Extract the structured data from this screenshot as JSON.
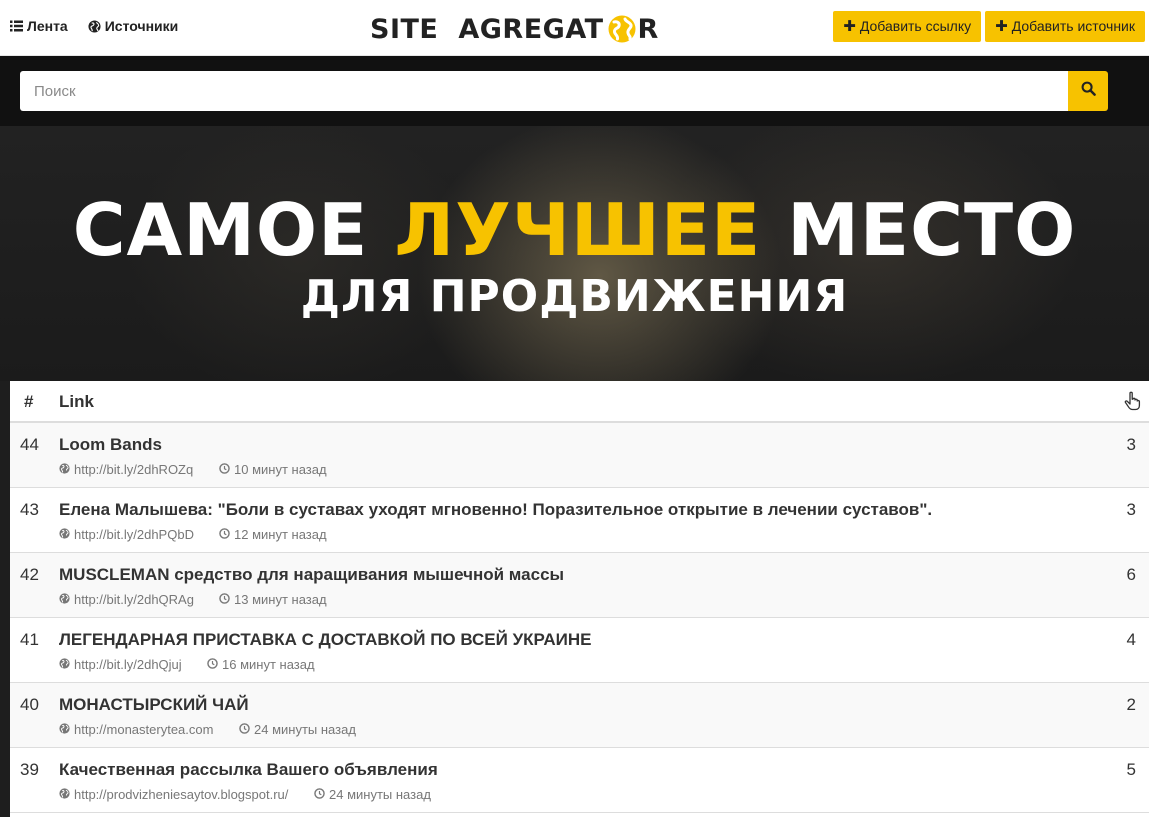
{
  "nav": {
    "feed_label": "Лента",
    "sources_label": "Источники",
    "brand_left": "SITE",
    "brand_right_a": "AGREGAT",
    "brand_right_b": "R",
    "add_link_label": "Добавить ссылку",
    "add_source_label": "Добавить источник"
  },
  "search": {
    "placeholder": "Поиск",
    "value": ""
  },
  "hero": {
    "title_part1": "САМОЕ",
    "title_accent": "ЛУЧШЕЕ",
    "title_part2": "МЕСТО",
    "subtitle": "ДЛЯ ПРОДВИЖЕНИЯ"
  },
  "table": {
    "header_num": "#",
    "header_link": "Link",
    "rows": [
      {
        "num": "44",
        "title": "Loom Bands",
        "url": "http://bit.ly/2dhROZq",
        "time": "10 минут назад",
        "count": "3"
      },
      {
        "num": "43",
        "title": "Елена Малышева: \"Боли в суставах уходят мгновенно! Поразительное открытие в лечении суставов\".",
        "url": "http://bit.ly/2dhPQbD",
        "time": "12 минут назад",
        "count": "3"
      },
      {
        "num": "42",
        "title": "MUSCLEMAN средство для наращивания мышечной массы",
        "url": "http://bit.ly/2dhQRAg",
        "time": "13 минут назад",
        "count": "6"
      },
      {
        "num": "41",
        "title": "ЛЕГЕНДАРНАЯ ПРИСТАВКА С ДОСТАВКОЙ ПО ВСЕЙ УКРАИНЕ",
        "url": "http://bit.ly/2dhQjuj",
        "time": "16 минут назад",
        "count": "4"
      },
      {
        "num": "40",
        "title": "МОНАСТЫРСКИЙ ЧАЙ",
        "url": "http://monasterytea.com",
        "time": "24 минуты назад",
        "count": "2"
      },
      {
        "num": "39",
        "title": "Качественная рассылка Вашего объявления",
        "url": "http://prodvizheniesaytov.blogspot.ru/",
        "time": "24 минуты назад",
        "count": "5"
      }
    ]
  },
  "colors": {
    "accent": "#f7c200",
    "dark": "#111111",
    "text": "#333333",
    "muted": "#777777"
  },
  "icons": {
    "feed": "list-icon",
    "sources": "globe-icon",
    "add": "plus-icon",
    "search": "search-icon",
    "vote": "hand-pointer-icon",
    "url": "globe-icon",
    "time": "clock-icon"
  }
}
